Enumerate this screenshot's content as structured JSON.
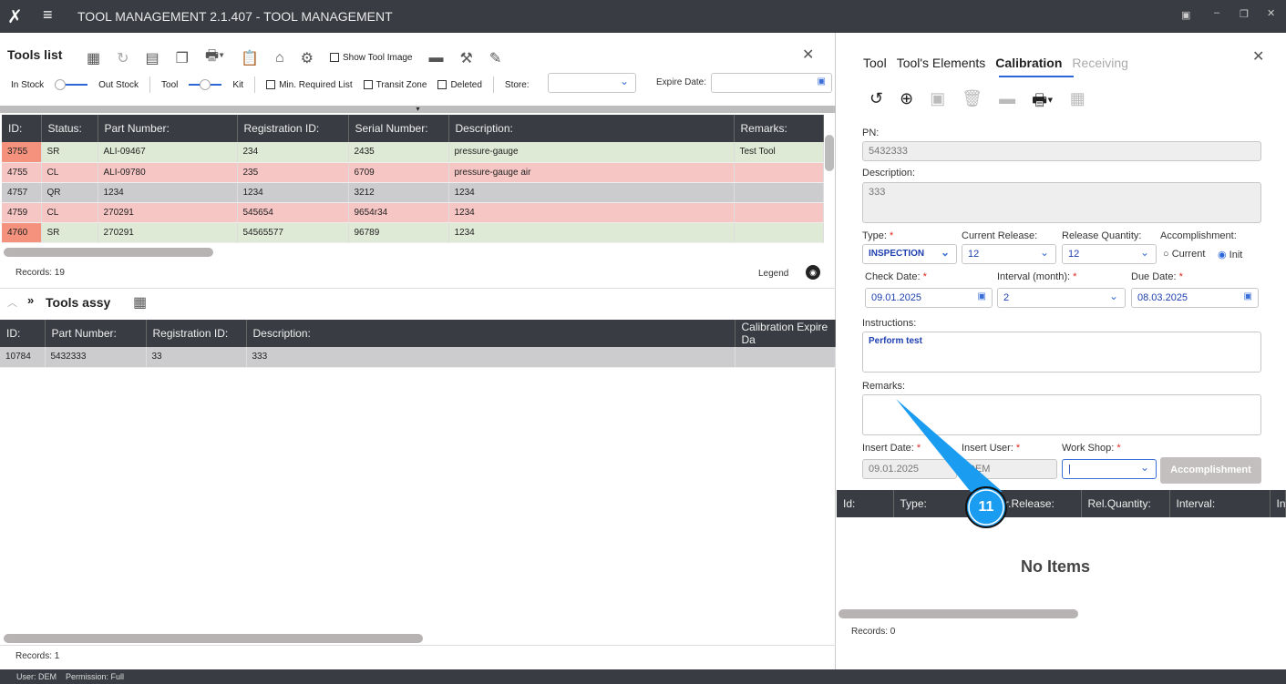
{
  "title": "TOOL MANAGEMENT 2.1.407 - TOOL MANAGEMENT",
  "tools_list": {
    "title": "Tools list",
    "show_tool_image": "Show Tool Image",
    "in_stock": "In Stock",
    "out_stock": "Out Stock",
    "tool": "Tool",
    "kit": "Kit",
    "min_required": "Min. Required List",
    "transit_zone": "Transit Zone",
    "deleted": "Deleted",
    "store": "Store:",
    "expire_date": "Expire Date:",
    "columns": [
      "ID:",
      "Status:",
      "Part Number:",
      "Registration ID:",
      "Serial Number:",
      "Description:",
      "Remarks:"
    ],
    "rows": [
      {
        "cls": "g",
        "hl": true,
        "cells": [
          "3755",
          "SR",
          "ALI-09467",
          "234",
          "2435",
          "pressure-gauge",
          "Test Tool"
        ]
      },
      {
        "cls": "r",
        "hl": false,
        "cells": [
          "4755",
          "CL",
          "ALI-09780",
          "235",
          "6709",
          "pressure-gauge air",
          ""
        ]
      },
      {
        "cls": "q",
        "hl": false,
        "cells": [
          "4757",
          "QR",
          "1234",
          "1234",
          "3212",
          "1234",
          ""
        ]
      },
      {
        "cls": "r",
        "hl": false,
        "cells": [
          "4759",
          "CL",
          "270291",
          "545654",
          "9654r34",
          "1234",
          ""
        ]
      },
      {
        "cls": "g",
        "hl": true,
        "cells": [
          "4760",
          "SR",
          "270291",
          "54565577",
          "96789",
          "1234",
          ""
        ]
      }
    ],
    "records": "Records: 19",
    "legend": "Legend"
  },
  "tools_assy": {
    "title": "Tools assy",
    "columns": [
      "ID:",
      "Part Number:",
      "Registration ID:",
      "Description:",
      "Calibration Expire Da"
    ],
    "rows": [
      [
        "10784",
        "5432333",
        "33",
        "333",
        ""
      ]
    ],
    "records": "Records: 1"
  },
  "status": {
    "user": "User: DEM",
    "permission": "Permission: Full"
  },
  "panel": {
    "tabs": [
      "Tool",
      "Tool's Elements",
      "Calibration",
      "Receiving"
    ],
    "active_tab": "Calibration",
    "pn_label": "PN:",
    "pn": "5432333",
    "desc_label": "Description:",
    "desc": "333",
    "type_label": "Type:",
    "type": "INSPECTION",
    "cur_rel_label": "Current Release:",
    "cur_rel": "12",
    "rel_qty_label": "Release Quantity:",
    "rel_qty": "12",
    "acc_label": "Accomplishment:",
    "acc_current": "Current",
    "acc_init": "Init",
    "check_label": "Check Date:",
    "check": "09.01.2025",
    "interval_label": "Interval (month):",
    "interval": "2",
    "due_label": "Due Date:",
    "due": "08.03.2025",
    "instr_label": "Instructions:",
    "instr": "Perform test",
    "remarks_label": "Remarks:",
    "insert_date_label": "Insert Date:",
    "insert_date": "09.01.2025",
    "insert_user_label": "Insert User:",
    "insert_user": "DEM",
    "workshop_label": "Work Shop:",
    "accomplishment_btn": "Accomplishment",
    "columns": [
      "Id:",
      "Type:",
      "Cur.Release:",
      "Rel.Quantity:",
      "Interval:",
      "In"
    ],
    "no_items": "No Items",
    "records": "Records: 0"
  },
  "callout": "11"
}
